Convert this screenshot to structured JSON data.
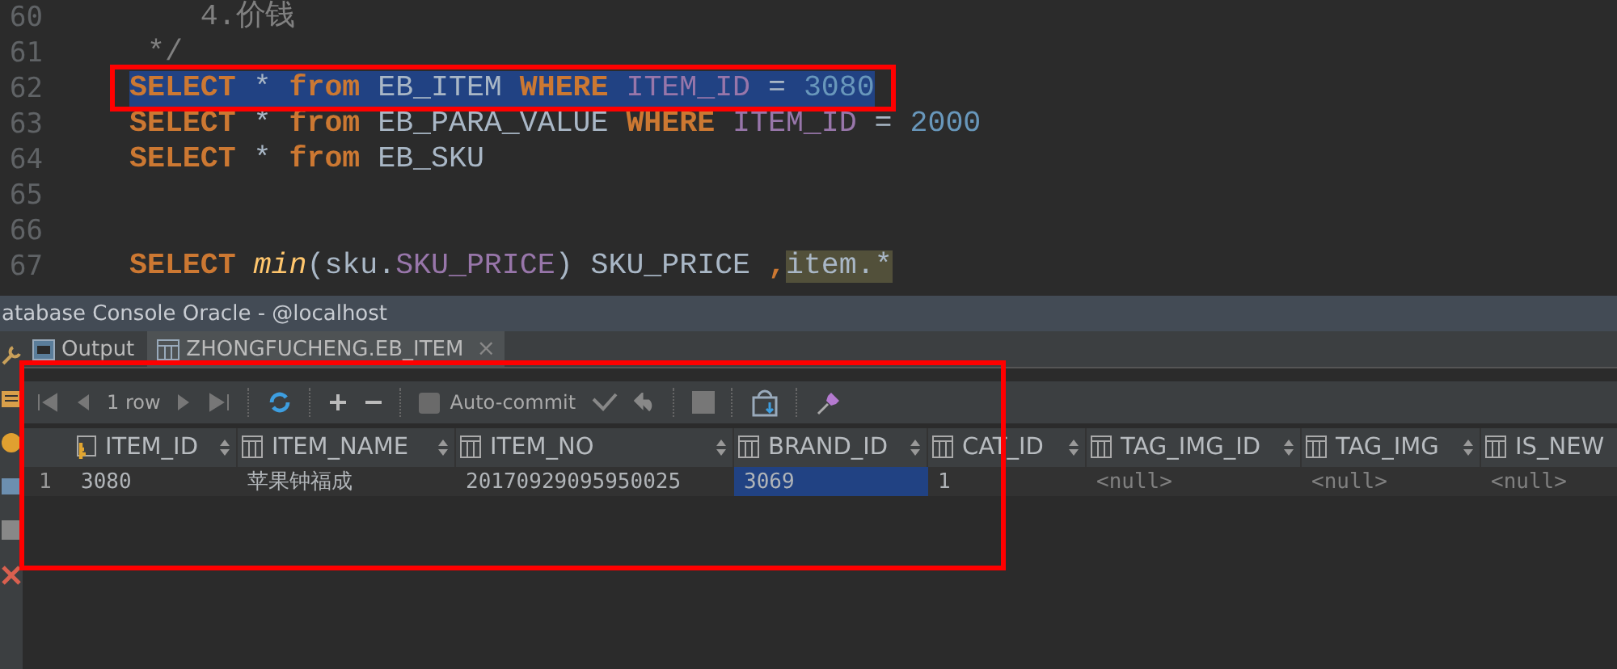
{
  "editor": {
    "lines": [
      {
        "number": "60",
        "selected": false,
        "tokens": [
          {
            "text": "    4.价钱",
            "kind": "comment"
          }
        ]
      },
      {
        "number": "61",
        "selected": false,
        "tokens": [
          {
            "text": " */",
            "kind": "comment"
          }
        ]
      },
      {
        "number": "62",
        "selected": true,
        "tokens": [
          {
            "text": "SELECT",
            "kind": "keyword"
          },
          {
            "text": " * ",
            "kind": "plain"
          },
          {
            "text": "from",
            "kind": "keyword"
          },
          {
            "text": " EB_ITEM ",
            "kind": "plain"
          },
          {
            "text": "WHERE",
            "kind": "keyword"
          },
          {
            "text": " ITEM_ID",
            "kind": "field"
          },
          {
            "text": " = ",
            "kind": "plain"
          },
          {
            "text": "3080",
            "kind": "number"
          }
        ]
      },
      {
        "number": "63",
        "selected": false,
        "tokens": [
          {
            "text": "SELECT",
            "kind": "keyword"
          },
          {
            "text": " * ",
            "kind": "plain"
          },
          {
            "text": "from",
            "kind": "keyword"
          },
          {
            "text": " EB_PARA_VALUE ",
            "kind": "plain"
          },
          {
            "text": "WHERE",
            "kind": "keyword"
          },
          {
            "text": " ITEM_ID",
            "kind": "field"
          },
          {
            "text": " = ",
            "kind": "plain"
          },
          {
            "text": "2000",
            "kind": "number"
          }
        ]
      },
      {
        "number": "64",
        "selected": false,
        "tokens": [
          {
            "text": "SELECT",
            "kind": "keyword"
          },
          {
            "text": " * ",
            "kind": "plain"
          },
          {
            "text": "from",
            "kind": "keyword"
          },
          {
            "text": " EB_SKU",
            "kind": "plain"
          }
        ]
      },
      {
        "number": "65",
        "selected": false
      },
      {
        "number": "66",
        "selected": false
      },
      {
        "number": "67",
        "selected": false,
        "tokens": [
          {
            "text": "SELECT",
            "kind": "keyword"
          },
          {
            "text": " min",
            "kind": "func"
          },
          {
            "text": "(sku.",
            "kind": "plain"
          },
          {
            "text": "SKU_PRICE",
            "kind": "field"
          },
          {
            "text": ") SKU_PRICE ",
            "kind": "plain"
          },
          {
            "text": ",",
            "kind": "keyword"
          },
          {
            "text": "item.*",
            "kind": "highlight"
          }
        ]
      }
    ]
  },
  "console": {
    "title": "atabase Console Oracle - @localhost",
    "tabs": [
      {
        "label": "Output",
        "kind": "output",
        "selected": false
      },
      {
        "label": "ZHONGFUCHENG.EB_ITEM",
        "kind": "table",
        "selected": true,
        "close": "×"
      }
    ],
    "toolbar": {
      "row_count": "1 row",
      "autocommit": {
        "label": "Auto-commit",
        "checked": false
      }
    },
    "table": {
      "columns": [
        {
          "name": "ITEM_ID",
          "kind": "key"
        },
        {
          "name": "ITEM_NAME",
          "kind": "column"
        },
        {
          "name": "ITEM_NO",
          "kind": "column"
        },
        {
          "name": "BRAND_ID",
          "kind": "column"
        },
        {
          "name": "CAT_ID",
          "kind": "column"
        },
        {
          "name": "TAG_IMG_ID",
          "kind": "column"
        },
        {
          "name": "TAG_IMG",
          "kind": "column"
        },
        {
          "name": "IS_NEW",
          "kind": "column"
        }
      ],
      "rows": [
        {
          "number": "1",
          "cells": [
            {
              "text": "3080",
              "kind": "value",
              "selected": false
            },
            {
              "text": "苹果钟福成",
              "kind": "value",
              "selected": false
            },
            {
              "text": "20170929095950025",
              "kind": "value",
              "selected": false
            },
            {
              "text": "3069",
              "kind": "value",
              "selected": true
            },
            {
              "text": "1",
              "kind": "value",
              "selected": false
            },
            {
              "text": "<null>",
              "kind": "null",
              "selected": false
            },
            {
              "text": "<null>",
              "kind": "null",
              "selected": false
            },
            {
              "text": "<null>",
              "kind": "null",
              "selected": false
            }
          ]
        }
      ]
    }
  }
}
